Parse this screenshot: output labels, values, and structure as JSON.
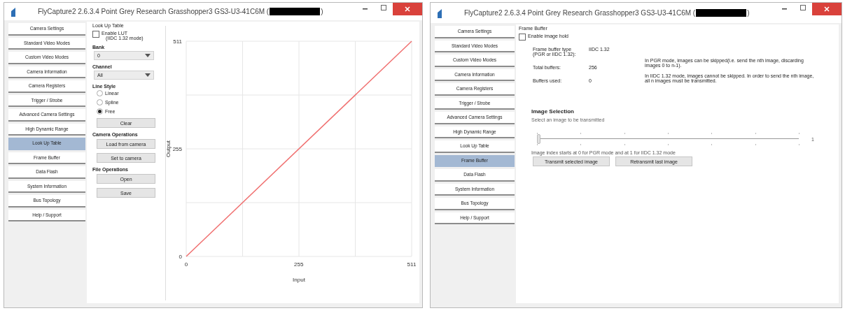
{
  "windows": [
    {
      "title": "FlyCapture2 2.6.3.4  Point Grey Research Grasshopper3 GS3-U3-41C6M (",
      "title_end": ")",
      "sidebar": {
        "items": [
          {
            "label": "Camera Settings",
            "selected": false
          },
          {
            "label": "Standard Video Modes",
            "selected": false
          },
          {
            "label": "Custom Video Modes",
            "selected": false
          },
          {
            "label": "Camera Information",
            "selected": false
          },
          {
            "label": "Camera Registers",
            "selected": false
          },
          {
            "label": "Trigger / Strobe",
            "selected": false
          },
          {
            "label": "Advanced Camera Settings",
            "selected": false
          },
          {
            "label": "High Dynamic Range",
            "selected": false
          },
          {
            "label": "Look Up Table",
            "selected": true
          },
          {
            "label": "Frame Buffer",
            "selected": false
          },
          {
            "label": "Data Flash",
            "selected": false
          },
          {
            "label": "System Information",
            "selected": false
          },
          {
            "label": "Bus Topology",
            "selected": false
          },
          {
            "label": "Help / Support",
            "selected": false
          }
        ]
      },
      "panel": {
        "kind": "lut",
        "group_title": "Look Up Table",
        "enable": {
          "label": "Enable LUT",
          "sublabel": "(IIDC 1.32 mode)",
          "checked": false
        },
        "bank": {
          "label": "Bank",
          "value": "0"
        },
        "channel": {
          "label": "Channel",
          "value": "All"
        },
        "line_style": {
          "label": "Line Style",
          "options": [
            {
              "label": "Linear",
              "selected": false
            },
            {
              "label": "Spline",
              "selected": false
            },
            {
              "label": "Free",
              "selected": true
            }
          ]
        },
        "clear_button": "Clear",
        "camera_ops": {
          "label": "Camera Operations",
          "buttons": [
            "Load from camera",
            "Set to camera"
          ]
        },
        "file_ops": {
          "label": "File Operations",
          "buttons": [
            "Open",
            "Save"
          ]
        },
        "chart_data": {
          "type": "line",
          "xlabel": "Input",
          "ylabel": "Output",
          "x": [
            0,
            511
          ],
          "series": [
            {
              "color": "#f07070",
              "values": [
                0,
                511
              ]
            }
          ],
          "xlim": [
            0,
            511
          ],
          "ylim": [
            0,
            511
          ],
          "xticks": [
            0,
            255,
            511
          ],
          "yticks": [
            0,
            255,
            511
          ]
        }
      }
    },
    {
      "title": "FlyCapture2 2.6.3.4  Point Grey Research Grasshopper3 GS3-U3-41C6M (",
      "title_end": ")",
      "sidebar": {
        "items": [
          {
            "label": "Camera Settings",
            "selected": false
          },
          {
            "label": "Standard Video Modes",
            "selected": false
          },
          {
            "label": "Custom Video Modes",
            "selected": false
          },
          {
            "label": "Camera Information",
            "selected": false
          },
          {
            "label": "Camera Registers",
            "selected": false
          },
          {
            "label": "Trigger / Strobe",
            "selected": false
          },
          {
            "label": "Advanced Camera Settings",
            "selected": false
          },
          {
            "label": "High Dynamic Range",
            "selected": false
          },
          {
            "label": "Look Up Table",
            "selected": false
          },
          {
            "label": "Frame Buffer",
            "selected": true
          },
          {
            "label": "Data Flash",
            "selected": false
          },
          {
            "label": "System Information",
            "selected": false
          },
          {
            "label": "Bus Topology",
            "selected": false
          },
          {
            "label": "Help / Support",
            "selected": false
          }
        ]
      },
      "panel": {
        "kind": "frame_buffer",
        "group_title": "Frame Buffer",
        "enable": {
          "label": "Enable image hold",
          "checked": false
        },
        "info": [
          {
            "label": "Frame buffer type (PGR or IIDC 1.32):",
            "value": "IIDC 1.32"
          },
          {
            "label": "Total buffers:",
            "value": "256"
          },
          {
            "label": "Buffers used:",
            "value": "0"
          }
        ],
        "notes": [
          "In PGR mode, images can be skipped(i.e. send the nth image, discarding images 0 to n-1).",
          "In IIDC 1.32 mode, images cannot be skipped. In order to send the nth image, all n images must be transmitted."
        ],
        "selection": {
          "title": "Image Selection",
          "subtitle": "Select an image to be transmitted",
          "level": 0,
          "reading": "1",
          "note": "Image index starts at 0 for PGR mode and at 1 for IIDC 1.32 mode",
          "buttons": [
            "Transmit selected image",
            "Retransmit last image"
          ]
        }
      }
    }
  ]
}
